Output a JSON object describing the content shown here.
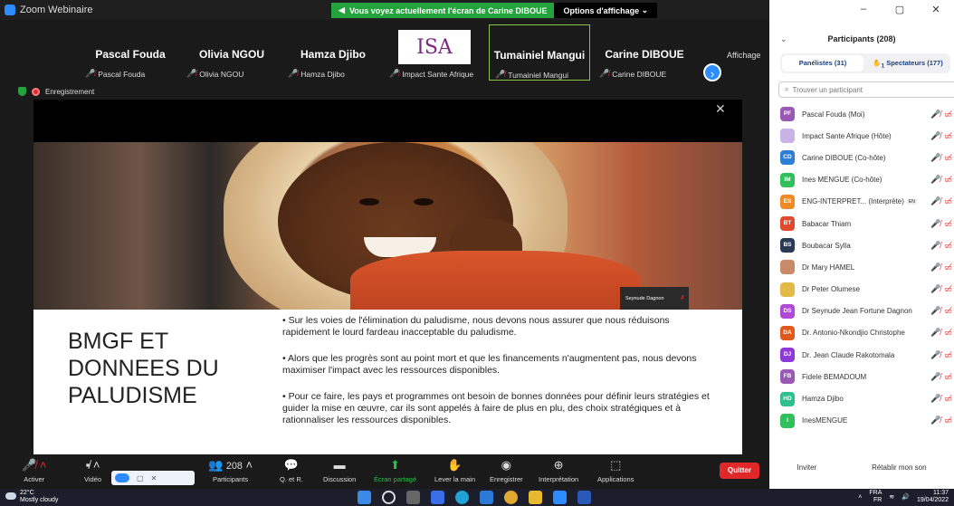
{
  "window": {
    "title": "Zoom Webinaire"
  },
  "share_banner": {
    "message": "Vous voyez actuellement l'écran de Carine DIBOUE",
    "options": "Options d'affichage"
  },
  "strip": {
    "affichage_label": "Affichage",
    "tiles": [
      {
        "name": "Pascal Fouda",
        "sub": "Pascal Fouda"
      },
      {
        "name": "Olivia NGOU",
        "sub": "Olivia NGOU"
      },
      {
        "name": "Hamza Djibo",
        "sub": "Hamza Djibo"
      },
      {
        "name": "",
        "sub": "Impact Sante Afrique",
        "logo_text": "ISA"
      },
      {
        "name": "Tumainiel Mangui",
        "sub": "Tumainiel Mangui"
      },
      {
        "name": "Carine DIBOUE",
        "sub": "Carine DIBOUE"
      }
    ]
  },
  "recording": {
    "label": "Enregistrement"
  },
  "slide": {
    "speaker_tag": "Seynude Dagnon",
    "title": "BMGF ET DONNEES DU PALUDISME",
    "bullets": [
      "•  Sur les voies de l'élimination du paludisme, nous devons nous assurer que nous réduisons rapidement le lourd fardeau inacceptable du paludisme.",
      "•  Alors que les progrès sont au point mort et que les financements n'augmentent pas, nous devons maximiser l'impact avec les ressources disponibles.",
      "•  Pour ce faire, les pays et programmes ont besoin de bonnes données pour définir leurs stratégies et guider la mise en œuvre, car ils sont appelés à faire de plus en plu, des choix stratégiques et à rationnaliser les ressources disponibles."
    ]
  },
  "panel": {
    "title": "Participants (208)",
    "tab_panelists": "Panélistes (31)",
    "tab_spectators": "Spectateurs (177)",
    "spectators_badge": "1",
    "search_placeholder": "Trouver un participant",
    "participants": [
      {
        "initials": "PF",
        "color": "#9b59b6",
        "name": "Pascal Fouda (Moi)"
      },
      {
        "initials": "",
        "color": "#c9b3e6",
        "name": "Impact Sante Afrique (Hôte)"
      },
      {
        "initials": "CD",
        "color": "#2d7fd6",
        "name": "Carine DIBOUE (Co-hôte)"
      },
      {
        "initials": "IM",
        "color": "#2fbf5b",
        "name": "Ines MENGUE (Co-hôte)"
      },
      {
        "initials": "ES",
        "color": "#f08a24",
        "name": "ENG-INTERPRET... (Interprète)",
        "badge": "EN"
      },
      {
        "initials": "BT",
        "color": "#e04a2d",
        "name": "Babacar Thiam"
      },
      {
        "initials": "BS",
        "color": "#2a3a55",
        "name": "Boubacar Sylla"
      },
      {
        "initials": "",
        "color": "#c98a6a",
        "name": "Dr Mary HAMEL"
      },
      {
        "initials": "",
        "color": "#e3b94a",
        "name": "Dr Peter Olumese"
      },
      {
        "initials": "DS",
        "color": "#b04ad6",
        "name": "Dr Seynude Jean Fortune Dagnon"
      },
      {
        "initials": "DA",
        "color": "#e05a1d",
        "name": "Dr. Antonio-Nkondjio Christophe"
      },
      {
        "initials": "DJ",
        "color": "#8e3ad6",
        "name": "Dr. Jean Claude Rakotomala"
      },
      {
        "initials": "FB",
        "color": "#9b59b6",
        "name": "Fidele BEMADOUM"
      },
      {
        "initials": "HD",
        "color": "#2fbf8b",
        "name": "Hamza Djibo"
      },
      {
        "initials": "I",
        "color": "#2fbf5b",
        "name": "InesMENGUE"
      }
    ],
    "invite": "Inviter",
    "unmute_all": "Rétablir mon son"
  },
  "toolbar": {
    "activer": "Activer",
    "video": "Vidéo",
    "participants": "Participants",
    "participants_count": "208",
    "qa": "Q. et R.",
    "discussion": "Discussion",
    "screen_share": "Écran partagé",
    "raise_hand": "Lever la main",
    "record": "Enregistrer",
    "interpretation": "Interprétation",
    "apps": "Applications",
    "quit": "Quitter"
  },
  "taskbar": {
    "temperature": "22°C",
    "weather": "Mostly cloudy",
    "lang": "FRA",
    "lang2": "FR",
    "time": "11:37",
    "date": "19/04/2022"
  }
}
